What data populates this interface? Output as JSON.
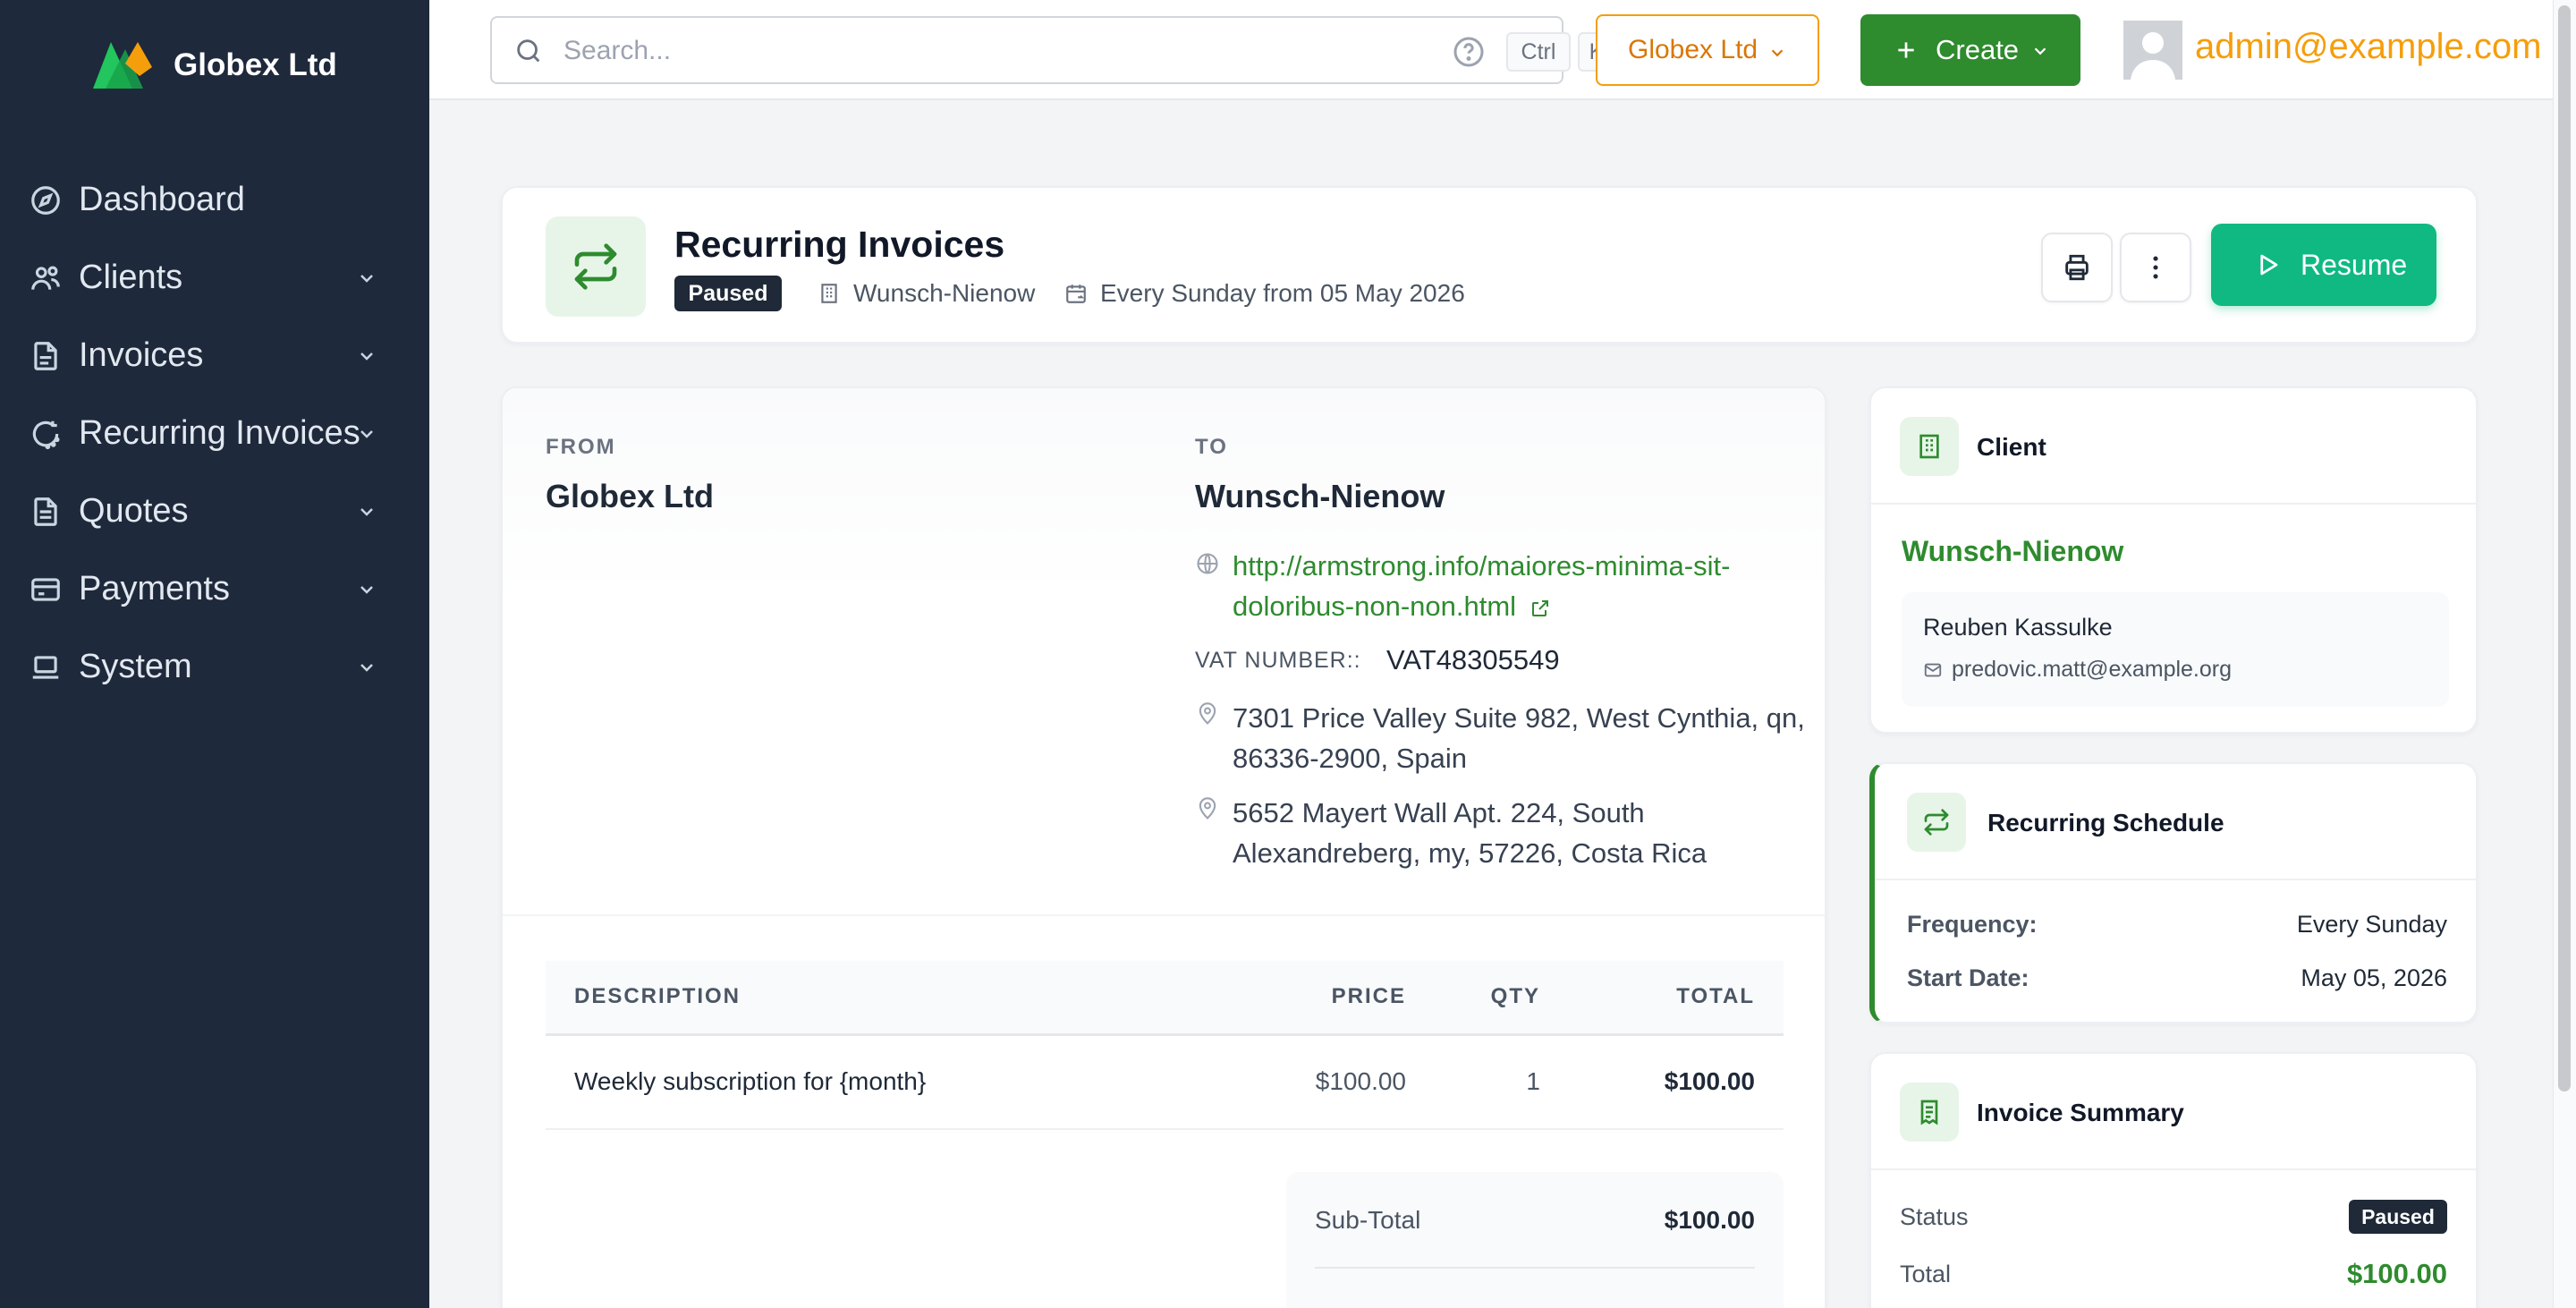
{
  "brand": {
    "name": "Globex Ltd"
  },
  "sidebar": {
    "items": [
      {
        "label": "Dashboard",
        "has_children": false
      },
      {
        "label": "Clients",
        "has_children": true
      },
      {
        "label": "Invoices",
        "has_children": true
      },
      {
        "label": "Recurring Invoices",
        "has_children": true
      },
      {
        "label": "Quotes",
        "has_children": true
      },
      {
        "label": "Payments",
        "has_children": true
      },
      {
        "label": "System",
        "has_children": true
      }
    ]
  },
  "topbar": {
    "search_placeholder": "Search...",
    "shortcut_ctrl": "Ctrl",
    "shortcut_key": "K",
    "company_label": "Globex Ltd",
    "create_label": "Create",
    "user_email": "admin@example.com"
  },
  "header": {
    "title": "Recurring Invoices",
    "status": "Paused",
    "client_name": "Wunsch-Nienow",
    "schedule": "Every Sunday from 05 May 2026",
    "resume_label": "Resume"
  },
  "invoice": {
    "from_label": "FROM",
    "from_name": "Globex Ltd",
    "to_label": "TO",
    "to_name": "Wunsch-Nienow",
    "website": "http://armstrong.info/maiores-minima-sit-doloribus-non-non.html",
    "vat_label": "VAT NUMBER::",
    "vat_number": "VAT48305549",
    "address_1": "7301 Price Valley Suite 982, West Cynthia, qn, 86336-2900, Spain",
    "address_2": "5652 Mayert Wall Apt. 224, South Alexandreberg, my, 57226, Costa Rica",
    "table": {
      "headers": {
        "description": "DESCRIPTION",
        "price": "PRICE",
        "qty": "QTY",
        "total": "TOTAL"
      },
      "rows": [
        {
          "description": "Weekly subscription for {month}",
          "price": "$100.00",
          "qty": "1",
          "total": "$100.00"
        }
      ]
    },
    "subtotal_label": "Sub-Total",
    "subtotal_value": "$100.00"
  },
  "client_card": {
    "title": "Client",
    "client_name": "Wunsch-Nienow",
    "contact_name": "Reuben Kassulke",
    "contact_email": "predovic.matt@example.org"
  },
  "schedule_card": {
    "title": "Recurring Schedule",
    "frequency_label": "Frequency:",
    "frequency_value": "Every Sunday",
    "start_label": "Start Date:",
    "start_value": "May 05, 2026"
  },
  "summary_card": {
    "title": "Invoice Summary",
    "status_label": "Status",
    "status_value": "Paused",
    "total_label": "Total",
    "total_value": "$100.00"
  },
  "icons": {
    "brand_logo": "globex-logo",
    "accent_color": "#2e8b2e",
    "resume_color": "#10b981",
    "warning_color": "#f59e0b",
    "sidebar_bg": "#1e293b"
  }
}
